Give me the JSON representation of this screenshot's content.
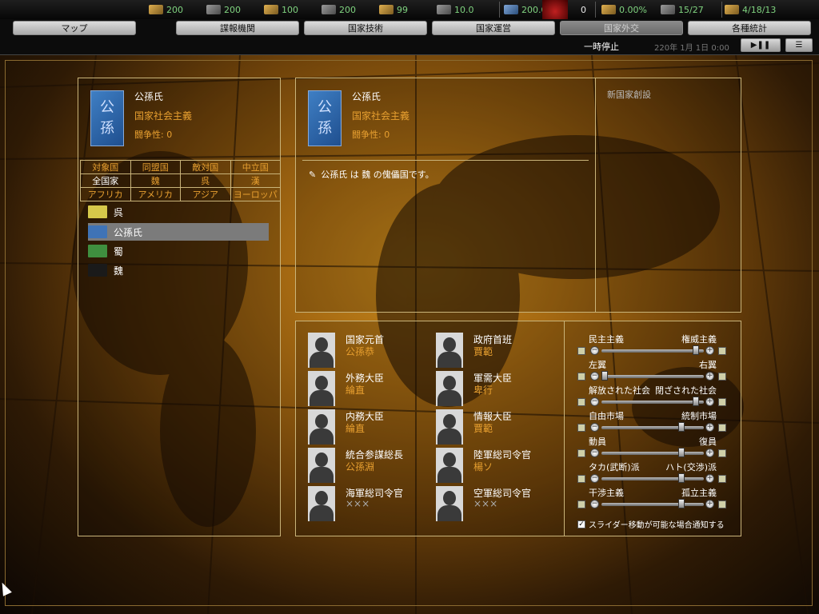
{
  "resources": [
    {
      "icon": "manpower-icon",
      "value": "200"
    },
    {
      "icon": "steel-icon",
      "value": "200"
    },
    {
      "icon": "rubber-icon",
      "value": "100"
    },
    {
      "icon": "oil-icon",
      "value": "200"
    },
    {
      "icon": "supplies-icon",
      "value": "99"
    },
    {
      "icon": "money-icon",
      "value": "10.0"
    },
    {
      "icon": "population-icon",
      "value": "200.0"
    },
    {
      "icon": "transport-icon",
      "value": "0"
    },
    {
      "icon": "dissent-icon",
      "value": "0.00%"
    },
    {
      "icon": "convoy-icon",
      "value": "15/27"
    },
    {
      "icon": "units-icon",
      "value": "4/18/13"
    }
  ],
  "tabs": [
    {
      "label": "マップ",
      "active": false
    },
    {
      "label": "諜報機関",
      "active": false
    },
    {
      "label": "国家技術",
      "active": false
    },
    {
      "label": "国家運営",
      "active": false
    },
    {
      "label": "国家外交",
      "active": true
    },
    {
      "label": "各種統計",
      "active": false
    }
  ],
  "status": {
    "pause_label": "一時停止",
    "date": "220年 1月 1日 0:00"
  },
  "left_panel": {
    "nation_name": "公孫氏",
    "ideology": "国家社会主義",
    "belligerence": "闘争性: 0",
    "flag_text": [
      "公",
      "孫"
    ],
    "filters": [
      [
        {
          "label": "対象国",
          "color": "orange"
        },
        {
          "label": "同盟国",
          "color": "orange"
        },
        {
          "label": "敵対国",
          "color": "orange"
        },
        {
          "label": "中立国",
          "color": "orange"
        }
      ],
      [
        {
          "label": "全国家",
          "color": "white"
        },
        {
          "label": "魏",
          "color": "orange"
        },
        {
          "label": "呉",
          "color": "orange"
        },
        {
          "label": "漢",
          "color": "orange"
        }
      ],
      [
        {
          "label": "アフリカ",
          "color": "orange"
        },
        {
          "label": "アメリカ",
          "color": "orange"
        },
        {
          "label": "アジア",
          "color": "orange"
        },
        {
          "label": "ヨーロッパ",
          "color": "orange"
        }
      ]
    ],
    "countries": [
      {
        "label": "呉",
        "flag_color": "#d6c84a",
        "selected": false
      },
      {
        "label": "公孫氏",
        "flag_color": "#3f73b6",
        "selected": true
      },
      {
        "label": "蜀",
        "flag_color": "#3f8f3f",
        "selected": false
      },
      {
        "label": "魏",
        "flag_color": "#1a1a1a",
        "selected": false
      }
    ]
  },
  "right_panel": {
    "nation_name": "公孫氏",
    "ideology": "国家社会主義",
    "belligerence": "闘争性: 0",
    "flag_text": [
      "公",
      "孫"
    ],
    "message": "公孫氏 は 魏 の傀儡国です。",
    "side_label": "新国家創設"
  },
  "ministers": [
    {
      "title": "国家元首",
      "name": "公孫恭"
    },
    {
      "title": "政府首班",
      "name": "賈範"
    },
    {
      "title": "外務大臣",
      "name": "綸直"
    },
    {
      "title": "軍需大臣",
      "name": "卑行"
    },
    {
      "title": "内務大臣",
      "name": "綸直"
    },
    {
      "title": "情報大臣",
      "name": "賈範"
    },
    {
      "title": "統合参謀総長",
      "name": "公孫淵"
    },
    {
      "title": "陸軍総司令官",
      "name": "楊ソ"
    },
    {
      "title": "海軍総司令官",
      "name": "×××"
    },
    {
      "title": "空軍総司令官",
      "name": "×××"
    }
  ],
  "sliders": [
    {
      "left": "民主主義",
      "right": "権威主義",
      "position": 0.95
    },
    {
      "left": "左翼",
      "right": "右翼",
      "position": 0.0
    },
    {
      "left": "解放された社会",
      "right": "閉ざされた社会",
      "position": 0.95
    },
    {
      "left": "自由市場",
      "right": "統制市場",
      "position": 0.8
    },
    {
      "left": "動員",
      "right": "復員",
      "position": 0.8
    },
    {
      "left": "タカ(武断)派",
      "right": "ハト(交渉)派",
      "position": 0.8
    },
    {
      "left": "干渉主義",
      "right": "孤立主義",
      "position": 0.8
    }
  ],
  "notify_label": "スライダー移動が可能な場合通知する"
}
